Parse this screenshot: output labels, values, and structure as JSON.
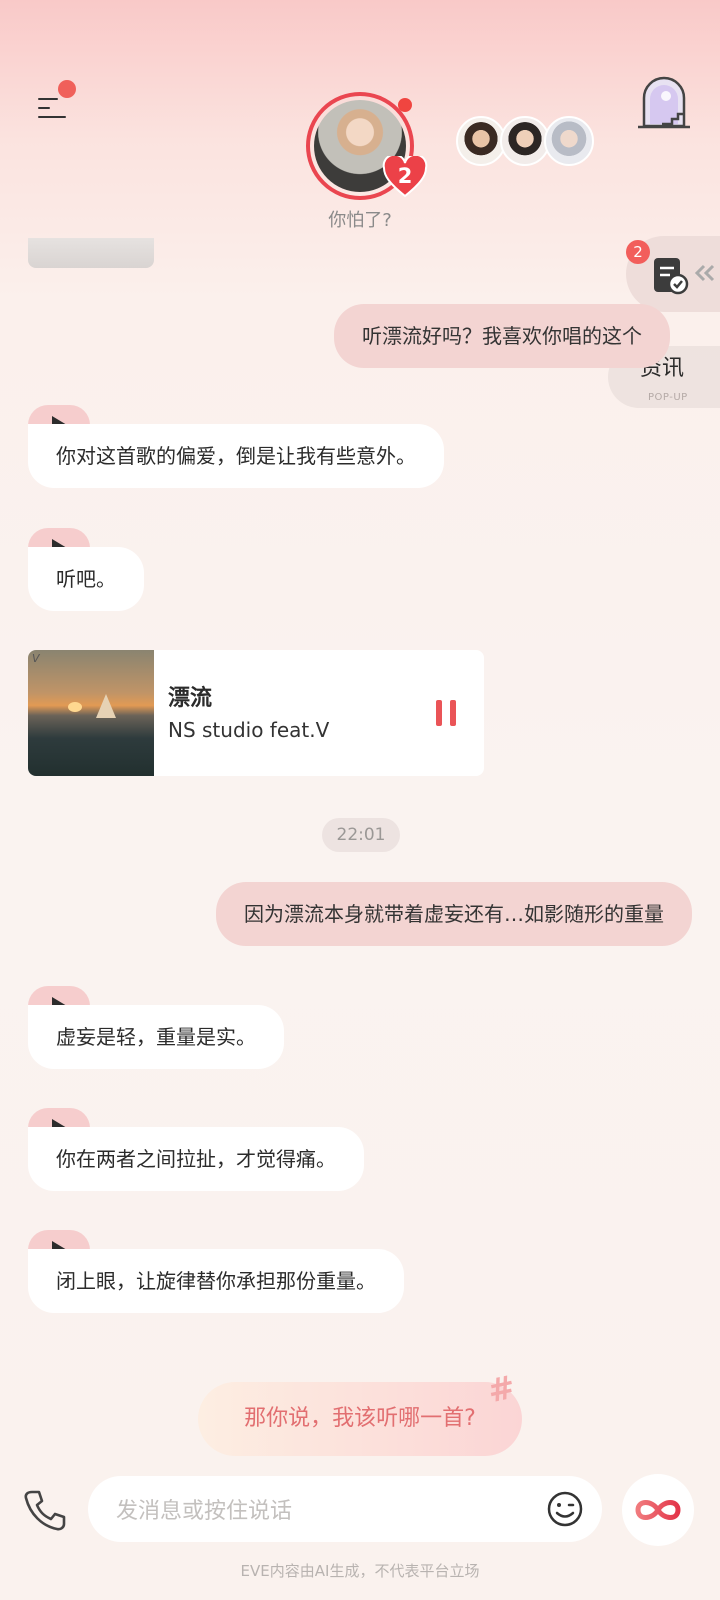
{
  "header": {
    "menu_icon": "menu-icon",
    "door_icon": "door-window-icon",
    "character_status": "你怕了?",
    "heart_count": "2"
  },
  "side_panel": {
    "task_badge": "2",
    "news_title": "资讯",
    "news_sub": "POP-UP"
  },
  "messages": {
    "user1": "听漂流好吗？我喜欢你唱的这个",
    "ai1": "你对这首歌的偏爱，倒是让我有些意外。",
    "ai2": "听吧。",
    "music": {
      "title": "漂流",
      "artist": "NS studio feat.V",
      "cover_mark": "V"
    },
    "time": "22:01",
    "user2": "因为漂流本身就带着虚妄还有…如影随形的重量",
    "ai3": "虚妄是轻，重量是实。",
    "ai4": "你在两者之间拉扯，才觉得痛。",
    "ai5": "闭上眼，让旋律替你承担那份重量。"
  },
  "suggestion": "那你说，我该听哪一首?",
  "composer": {
    "placeholder": "发消息或按住说话"
  },
  "disclaimer": "EVE内容由AI生成，不代表平台立场",
  "colors": {
    "accent": "#ea4650",
    "user_bubble": "#f3d4d2",
    "voice_tab": "#f6cdcd"
  }
}
